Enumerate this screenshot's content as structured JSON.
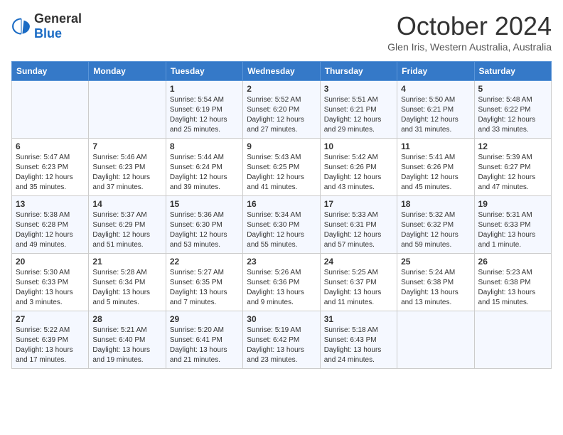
{
  "logo": {
    "general": "General",
    "blue": "Blue"
  },
  "header": {
    "month": "October 2024",
    "location": "Glen Iris, Western Australia, Australia"
  },
  "weekdays": [
    "Sunday",
    "Monday",
    "Tuesday",
    "Wednesday",
    "Thursday",
    "Friday",
    "Saturday"
  ],
  "weeks": [
    [
      {
        "day": "",
        "sunrise": "",
        "sunset": "",
        "daylight": ""
      },
      {
        "day": "",
        "sunrise": "",
        "sunset": "",
        "daylight": ""
      },
      {
        "day": "1",
        "sunrise": "Sunrise: 5:54 AM",
        "sunset": "Sunset: 6:19 PM",
        "daylight": "Daylight: 12 hours and 25 minutes."
      },
      {
        "day": "2",
        "sunrise": "Sunrise: 5:52 AM",
        "sunset": "Sunset: 6:20 PM",
        "daylight": "Daylight: 12 hours and 27 minutes."
      },
      {
        "day": "3",
        "sunrise": "Sunrise: 5:51 AM",
        "sunset": "Sunset: 6:21 PM",
        "daylight": "Daylight: 12 hours and 29 minutes."
      },
      {
        "day": "4",
        "sunrise": "Sunrise: 5:50 AM",
        "sunset": "Sunset: 6:21 PM",
        "daylight": "Daylight: 12 hours and 31 minutes."
      },
      {
        "day": "5",
        "sunrise": "Sunrise: 5:48 AM",
        "sunset": "Sunset: 6:22 PM",
        "daylight": "Daylight: 12 hours and 33 minutes."
      }
    ],
    [
      {
        "day": "6",
        "sunrise": "Sunrise: 5:47 AM",
        "sunset": "Sunset: 6:23 PM",
        "daylight": "Daylight: 12 hours and 35 minutes."
      },
      {
        "day": "7",
        "sunrise": "Sunrise: 5:46 AM",
        "sunset": "Sunset: 6:23 PM",
        "daylight": "Daylight: 12 hours and 37 minutes."
      },
      {
        "day": "8",
        "sunrise": "Sunrise: 5:44 AM",
        "sunset": "Sunset: 6:24 PM",
        "daylight": "Daylight: 12 hours and 39 minutes."
      },
      {
        "day": "9",
        "sunrise": "Sunrise: 5:43 AM",
        "sunset": "Sunset: 6:25 PM",
        "daylight": "Daylight: 12 hours and 41 minutes."
      },
      {
        "day": "10",
        "sunrise": "Sunrise: 5:42 AM",
        "sunset": "Sunset: 6:26 PM",
        "daylight": "Daylight: 12 hours and 43 minutes."
      },
      {
        "day": "11",
        "sunrise": "Sunrise: 5:41 AM",
        "sunset": "Sunset: 6:26 PM",
        "daylight": "Daylight: 12 hours and 45 minutes."
      },
      {
        "day": "12",
        "sunrise": "Sunrise: 5:39 AM",
        "sunset": "Sunset: 6:27 PM",
        "daylight": "Daylight: 12 hours and 47 minutes."
      }
    ],
    [
      {
        "day": "13",
        "sunrise": "Sunrise: 5:38 AM",
        "sunset": "Sunset: 6:28 PM",
        "daylight": "Daylight: 12 hours and 49 minutes."
      },
      {
        "day": "14",
        "sunrise": "Sunrise: 5:37 AM",
        "sunset": "Sunset: 6:29 PM",
        "daylight": "Daylight: 12 hours and 51 minutes."
      },
      {
        "day": "15",
        "sunrise": "Sunrise: 5:36 AM",
        "sunset": "Sunset: 6:30 PM",
        "daylight": "Daylight: 12 hours and 53 minutes."
      },
      {
        "day": "16",
        "sunrise": "Sunrise: 5:34 AM",
        "sunset": "Sunset: 6:30 PM",
        "daylight": "Daylight: 12 hours and 55 minutes."
      },
      {
        "day": "17",
        "sunrise": "Sunrise: 5:33 AM",
        "sunset": "Sunset: 6:31 PM",
        "daylight": "Daylight: 12 hours and 57 minutes."
      },
      {
        "day": "18",
        "sunrise": "Sunrise: 5:32 AM",
        "sunset": "Sunset: 6:32 PM",
        "daylight": "Daylight: 12 hours and 59 minutes."
      },
      {
        "day": "19",
        "sunrise": "Sunrise: 5:31 AM",
        "sunset": "Sunset: 6:33 PM",
        "daylight": "Daylight: 13 hours and 1 minute."
      }
    ],
    [
      {
        "day": "20",
        "sunrise": "Sunrise: 5:30 AM",
        "sunset": "Sunset: 6:33 PM",
        "daylight": "Daylight: 13 hours and 3 minutes."
      },
      {
        "day": "21",
        "sunrise": "Sunrise: 5:28 AM",
        "sunset": "Sunset: 6:34 PM",
        "daylight": "Daylight: 13 hours and 5 minutes."
      },
      {
        "day": "22",
        "sunrise": "Sunrise: 5:27 AM",
        "sunset": "Sunset: 6:35 PM",
        "daylight": "Daylight: 13 hours and 7 minutes."
      },
      {
        "day": "23",
        "sunrise": "Sunrise: 5:26 AM",
        "sunset": "Sunset: 6:36 PM",
        "daylight": "Daylight: 13 hours and 9 minutes."
      },
      {
        "day": "24",
        "sunrise": "Sunrise: 5:25 AM",
        "sunset": "Sunset: 6:37 PM",
        "daylight": "Daylight: 13 hours and 11 minutes."
      },
      {
        "day": "25",
        "sunrise": "Sunrise: 5:24 AM",
        "sunset": "Sunset: 6:38 PM",
        "daylight": "Daylight: 13 hours and 13 minutes."
      },
      {
        "day": "26",
        "sunrise": "Sunrise: 5:23 AM",
        "sunset": "Sunset: 6:38 PM",
        "daylight": "Daylight: 13 hours and 15 minutes."
      }
    ],
    [
      {
        "day": "27",
        "sunrise": "Sunrise: 5:22 AM",
        "sunset": "Sunset: 6:39 PM",
        "daylight": "Daylight: 13 hours and 17 minutes."
      },
      {
        "day": "28",
        "sunrise": "Sunrise: 5:21 AM",
        "sunset": "Sunset: 6:40 PM",
        "daylight": "Daylight: 13 hours and 19 minutes."
      },
      {
        "day": "29",
        "sunrise": "Sunrise: 5:20 AM",
        "sunset": "Sunset: 6:41 PM",
        "daylight": "Daylight: 13 hours and 21 minutes."
      },
      {
        "day": "30",
        "sunrise": "Sunrise: 5:19 AM",
        "sunset": "Sunset: 6:42 PM",
        "daylight": "Daylight: 13 hours and 23 minutes."
      },
      {
        "day": "31",
        "sunrise": "Sunrise: 5:18 AM",
        "sunset": "Sunset: 6:43 PM",
        "daylight": "Daylight: 13 hours and 24 minutes."
      },
      {
        "day": "",
        "sunrise": "",
        "sunset": "",
        "daylight": ""
      },
      {
        "day": "",
        "sunrise": "",
        "sunset": "",
        "daylight": ""
      }
    ]
  ]
}
